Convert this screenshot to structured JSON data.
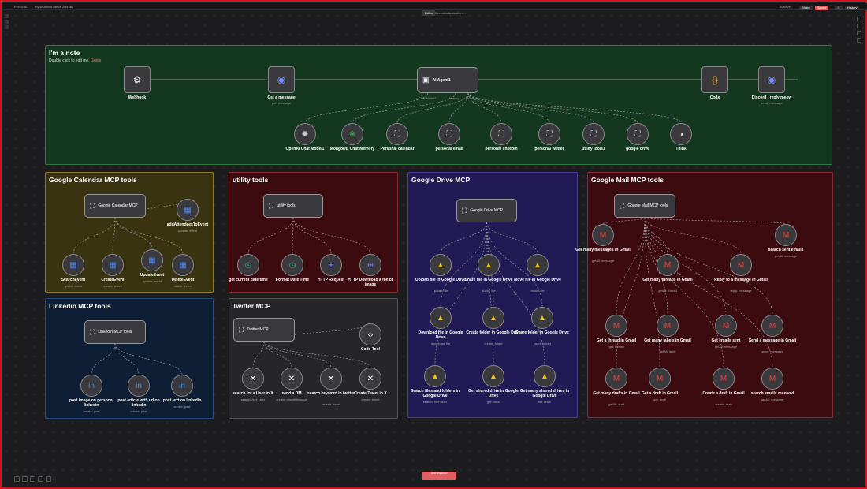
{
  "topbar": {
    "personal": "Personal",
    "breadcrumb": "my-workflow-name",
    "tag": "+ Add tag",
    "inactive": "Inactive",
    "share": "Share",
    "save": "Saved",
    "history": "History"
  },
  "tabs": [
    "Editor",
    "Executions",
    "Evaluations"
  ],
  "test_button": "Test workflow",
  "stickies": {
    "note": {
      "title": "I'm a note",
      "sub": "Double click to edit me. ",
      "guide": "Guide"
    },
    "gcal": "Google Calendar MCP tools",
    "util": "utility tools",
    "gdrive": "Google Drive MCP",
    "gmail": "Google Mail MCP tools",
    "linkedin": "Linkedin MCP tools",
    "twitter": "Twitter MCP"
  },
  "main": {
    "webhook": "Webhook",
    "get_message": "Get a message",
    "get_message_sub": "get: message",
    "agent": "AI Agent1",
    "code": "Code",
    "discord_reply": "Discord - reply meow",
    "discord_sub": "send: message",
    "agent_ports": [
      "Chat Model*",
      "Memory",
      "Tool"
    ],
    "tools": [
      [
        "OpenAI Chat Model1",
        ""
      ],
      [
        "MongoDB Chat Memory",
        ""
      ],
      [
        "Personal calendar",
        ""
      ],
      [
        "personal email",
        ""
      ],
      [
        "personal linkedin",
        ""
      ],
      [
        "personal twitter",
        ""
      ],
      [
        "utility tools1",
        ""
      ],
      [
        "google drive",
        ""
      ],
      [
        "Think",
        ""
      ]
    ]
  },
  "gcal": {
    "trigger": "Google Calendar MCP",
    "items": [
      [
        "SearchEvent",
        "getAll: event"
      ],
      [
        "CreateEvent",
        "create: event"
      ],
      [
        "UpdateEvent",
        "update: event"
      ],
      [
        "DeleteEvent",
        "delete: event"
      ],
      [
        "addAttendeesToEvent",
        "update: event"
      ]
    ]
  },
  "util": {
    "trigger": "utility tools",
    "items": [
      [
        "get current date time",
        ""
      ],
      [
        "Format Date Time",
        ""
      ],
      [
        "HTTP Request",
        ""
      ],
      [
        "HTTP Download a file or image",
        ""
      ]
    ]
  },
  "gdrive": {
    "trigger": "Google Drive MCP",
    "items": [
      [
        "Upload file in Google Drive",
        "upload: file"
      ],
      [
        "Share file in Google Drive",
        "share: file"
      ],
      [
        "Move file in Google Drive",
        "move: file"
      ],
      [
        "Download file in Google Drive",
        "download: file"
      ],
      [
        "Create folder in Google Drive",
        "create: folder"
      ],
      [
        "Share folder in Google Drive",
        "share: folder"
      ],
      [
        "Search files and folders in Google Drive",
        "search: fileFolder"
      ],
      [
        "Get shared drive in Google Drive",
        "get: drive"
      ],
      [
        "Get many shared drives in Google Drive",
        "list: drive"
      ]
    ]
  },
  "gmail": {
    "trigger": "Google Mail MCP tools",
    "items": [
      [
        "Get many messages in Gmail",
        "getAll: message"
      ],
      [
        "search sent emails",
        "getAll: message"
      ],
      [
        "Get many threads in Gmail",
        "getAll: thread"
      ],
      [
        "Reply to a message in Gmail",
        "reply: message"
      ],
      [
        "Get a thread in Gmail",
        "get: thread"
      ],
      [
        "Get many labels in Gmail",
        "getAll: label"
      ],
      [
        "Get emails sent",
        "getAll: message"
      ],
      [
        "Send a message in Gmail",
        "send: message"
      ],
      [
        "Get many drafts in Gmail",
        "getAll: draft"
      ],
      [
        "Get a draft in Gmail",
        "get: draft"
      ],
      [
        "Create a draft in Gmail",
        "create: draft"
      ],
      [
        "search emails received",
        "getAll: message"
      ]
    ]
  },
  "linkedin": {
    "trigger": "Linkedin MCP tools",
    "items": [
      [
        "post image on personal linkedin",
        "create: post"
      ],
      [
        "post article with url on linkedin",
        "create: post"
      ],
      [
        "post text on linkedin",
        "create: post"
      ]
    ]
  },
  "twitter": {
    "trigger": "Twitter MCP",
    "items": [
      [
        "search for a User in X",
        "searchUser: user"
      ],
      [
        "send a DM",
        "create: directMessage"
      ],
      [
        "search keyword in twitter",
        "search: tweet"
      ],
      [
        "Create Tweet in X",
        "create: tweet"
      ],
      [
        "Code Tool",
        ""
      ]
    ]
  }
}
